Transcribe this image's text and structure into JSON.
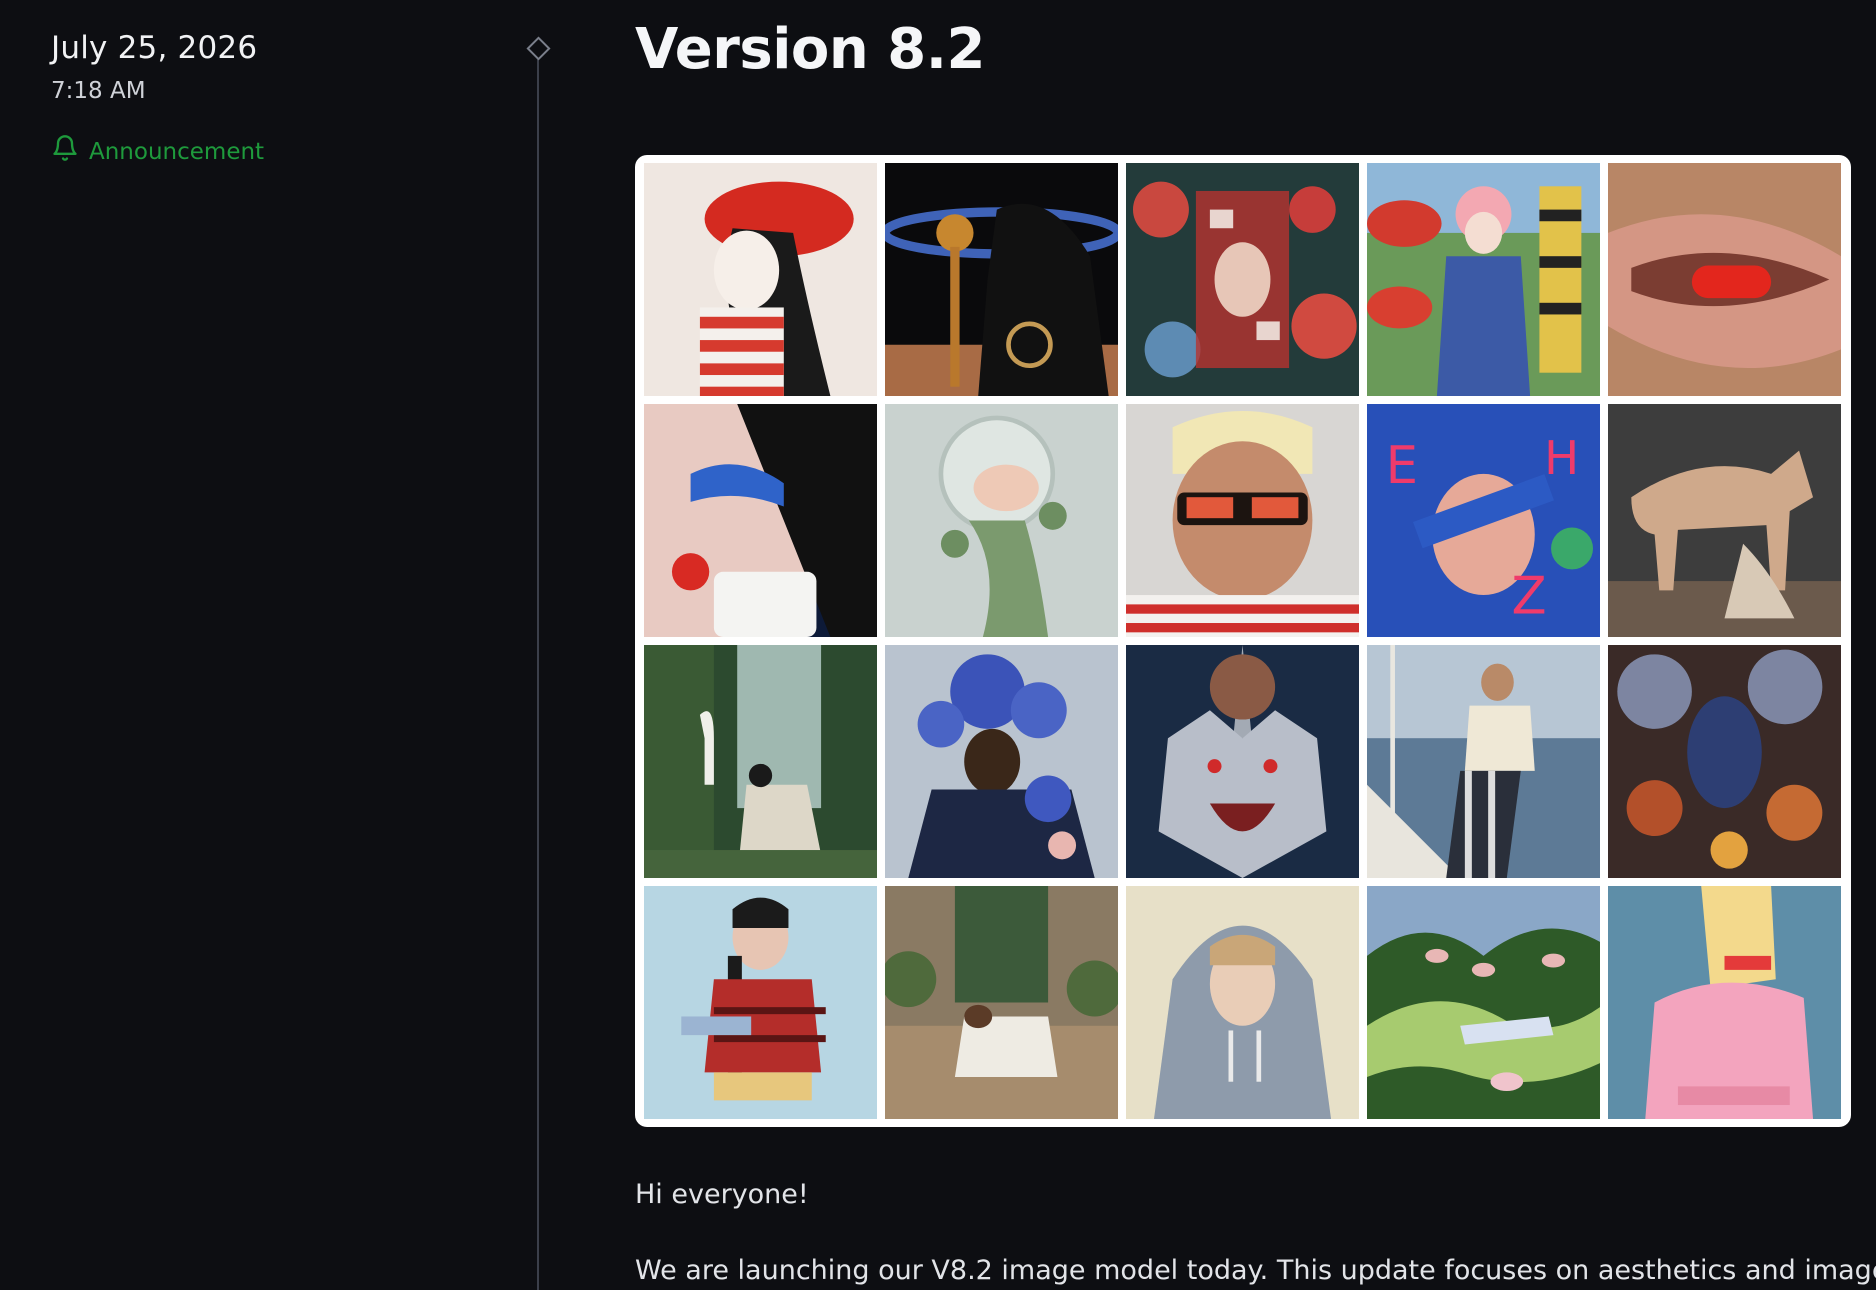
{
  "post": {
    "date": "July 25, 2026",
    "time": "7:18 AM",
    "tag": "Announcement",
    "tag_icon": "bell-icon",
    "tag_color": "#1e9a3c",
    "title": "Version 8.2"
  },
  "gallery": {
    "rows": 4,
    "columns": 5
  },
  "body": {
    "greeting": "Hi everyone!",
    "intro": "We are launching our V8.2 image model today. This update focuses on aesthetics and image"
  }
}
